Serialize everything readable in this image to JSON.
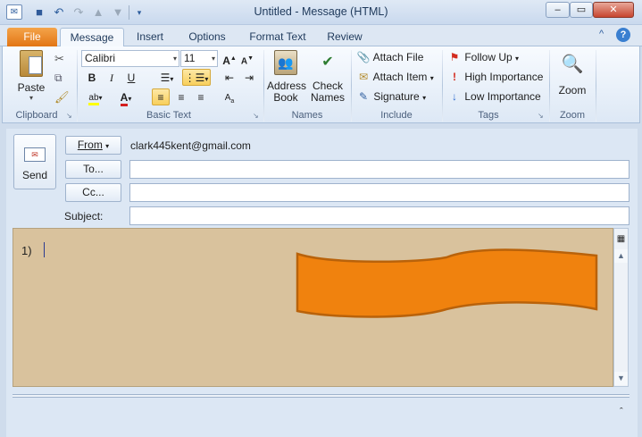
{
  "window": {
    "title": "Untitled  -  Message (HTML)",
    "controls": {
      "minimize": "–",
      "maximize": "▭",
      "close": "✕"
    }
  },
  "tabs": [
    {
      "label": "File"
    },
    {
      "label": "Message"
    },
    {
      "label": "Insert"
    },
    {
      "label": "Options"
    },
    {
      "label": "Format Text"
    },
    {
      "label": "Review"
    }
  ],
  "ribbon": {
    "clipboard": {
      "label": "Clipboard",
      "paste": "Paste"
    },
    "basic_text": {
      "label": "Basic Text",
      "font": "Calibri",
      "size": "11",
      "bold": "B",
      "italic": "I",
      "underline": "U"
    },
    "names": {
      "label": "Names",
      "address_book": "Address\nBook",
      "check_names": "Check\nNames"
    },
    "include": {
      "label": "Include",
      "attach_file": "Attach File",
      "attach_item": "Attach Item",
      "signature": "Signature"
    },
    "tags": {
      "label": "Tags",
      "follow_up": "Follow Up",
      "high_importance": "High Importance",
      "low_importance": "Low Importance"
    },
    "zoom": {
      "label": "Zoom",
      "zoom": "Zoom"
    }
  },
  "compose": {
    "send": "Send",
    "from_label": "From",
    "from_email": "clark445kent@gmail.com",
    "to_label": "To...",
    "cc_label": "Cc...",
    "subject_label": "Subject:",
    "to_value": "",
    "cc_value": "",
    "subject_value": ""
  },
  "body": {
    "text": "1)",
    "background_color": "#d9c29d",
    "shape_fill": "#f0820e",
    "shape_stroke": "#b9620a"
  },
  "colors": {
    "file_tab": "#e27514",
    "accent": "#1e395b"
  }
}
